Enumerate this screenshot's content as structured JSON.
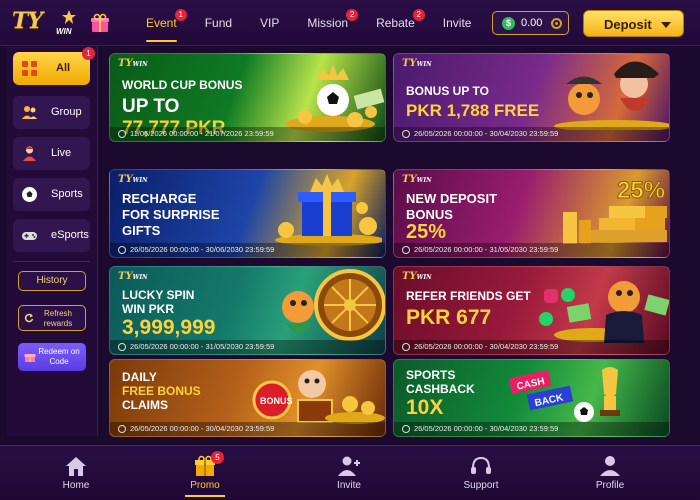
{
  "logo": {
    "main": "TY",
    "sub": "WIN"
  },
  "nav": [
    {
      "label": "Event",
      "badge": "1"
    },
    {
      "label": "Fund",
      "badge": ""
    },
    {
      "label": "VIP",
      "badge": ""
    },
    {
      "label": "Mission",
      "badge": "2"
    },
    {
      "label": "Rebate",
      "badge": "2"
    },
    {
      "label": "Invite",
      "badge": ""
    }
  ],
  "balance": {
    "currency_icon": "$",
    "amount": "0.00"
  },
  "deposit": {
    "label": "Deposit"
  },
  "sidebar": {
    "categories": [
      {
        "label": "All",
        "badge": "1"
      },
      {
        "label": "Group"
      },
      {
        "label": "Live"
      },
      {
        "label": "Sports"
      },
      {
        "label": "eSports"
      }
    ],
    "history_label": "History",
    "refresh_label": "Refresh rewards",
    "redeem_label": "Redeem on Code"
  },
  "banners": [
    {
      "logo": "TY",
      "logo_sub": "WIN",
      "line1": "WORLD CUP BONUS",
      "line2": "UP TO",
      "line3": "77,777 PKR",
      "date": "11/06/2026 00:00:00 - 21/07/2026 23:59:59"
    },
    {
      "logo": "TY",
      "logo_sub": "WIN",
      "line1": "BONUS UP TO",
      "line2": "PKR 1,788 FREE",
      "date": "26/05/2026 00:00:00 - 30/04/2030 23:59:59"
    },
    {
      "logo": "TY",
      "logo_sub": "WIN",
      "line1": "RECHARGE",
      "line2": "FOR SURPRISE",
      "line3": "GIFTS",
      "date": "26/05/2026 00:00:00 - 30/06/2030 23:59:59"
    },
    {
      "logo": "TY",
      "logo_sub": "WIN",
      "line1": "NEW DEPOSIT",
      "line2": "BONUS",
      "line3": "25%",
      "art_text": "25%",
      "date": "26/05/2026 00:00:00 - 31/05/2030 23:59:59"
    },
    {
      "logo": "TY",
      "logo_sub": "WIN",
      "line1": "LUCKY SPIN",
      "line2": "WIN PKR",
      "line3": "3,999,999",
      "date": "26/05/2026 00:00:00 - 31/05/2030 23:59:59"
    },
    {
      "logo": "TY",
      "logo_sub": "WIN",
      "line1": "REFER FRIENDS GET",
      "line2": "PKR 677",
      "date": "26/05/2026 00:00:00 - 30/04/2030 23:59:59"
    },
    {
      "logo": "TY",
      "logo_sub": "WIN",
      "line1": "DAILY",
      "line2": "FREE BONUS",
      "line3": "CLAIMS",
      "art_text": "BONUS",
      "date": "26/05/2026 00:00:00 - 30/04/2030 23:59:59"
    },
    {
      "logo": "TY",
      "logo_sub": "WIN",
      "line1": "SPORTS",
      "line2": "CASHBACK",
      "line3": "10X",
      "art_text1": "CASH",
      "art_text2": "BACK",
      "date": "26/05/2026 00:00:00 - 30/04/2030 23:59:59"
    }
  ],
  "bottom_nav": [
    {
      "label": "Home",
      "icon": "home-icon"
    },
    {
      "label": "Promo",
      "icon": "gift-icon",
      "badge": "5"
    },
    {
      "label": "Invite",
      "icon": "add-user-icon"
    },
    {
      "label": "Support",
      "icon": "headset-icon"
    },
    {
      "label": "Profile",
      "icon": "user-icon"
    }
  ],
  "colors": {
    "accent": "#ffcc2e",
    "background": "#1b0a2e",
    "badge": "#e5243b"
  }
}
